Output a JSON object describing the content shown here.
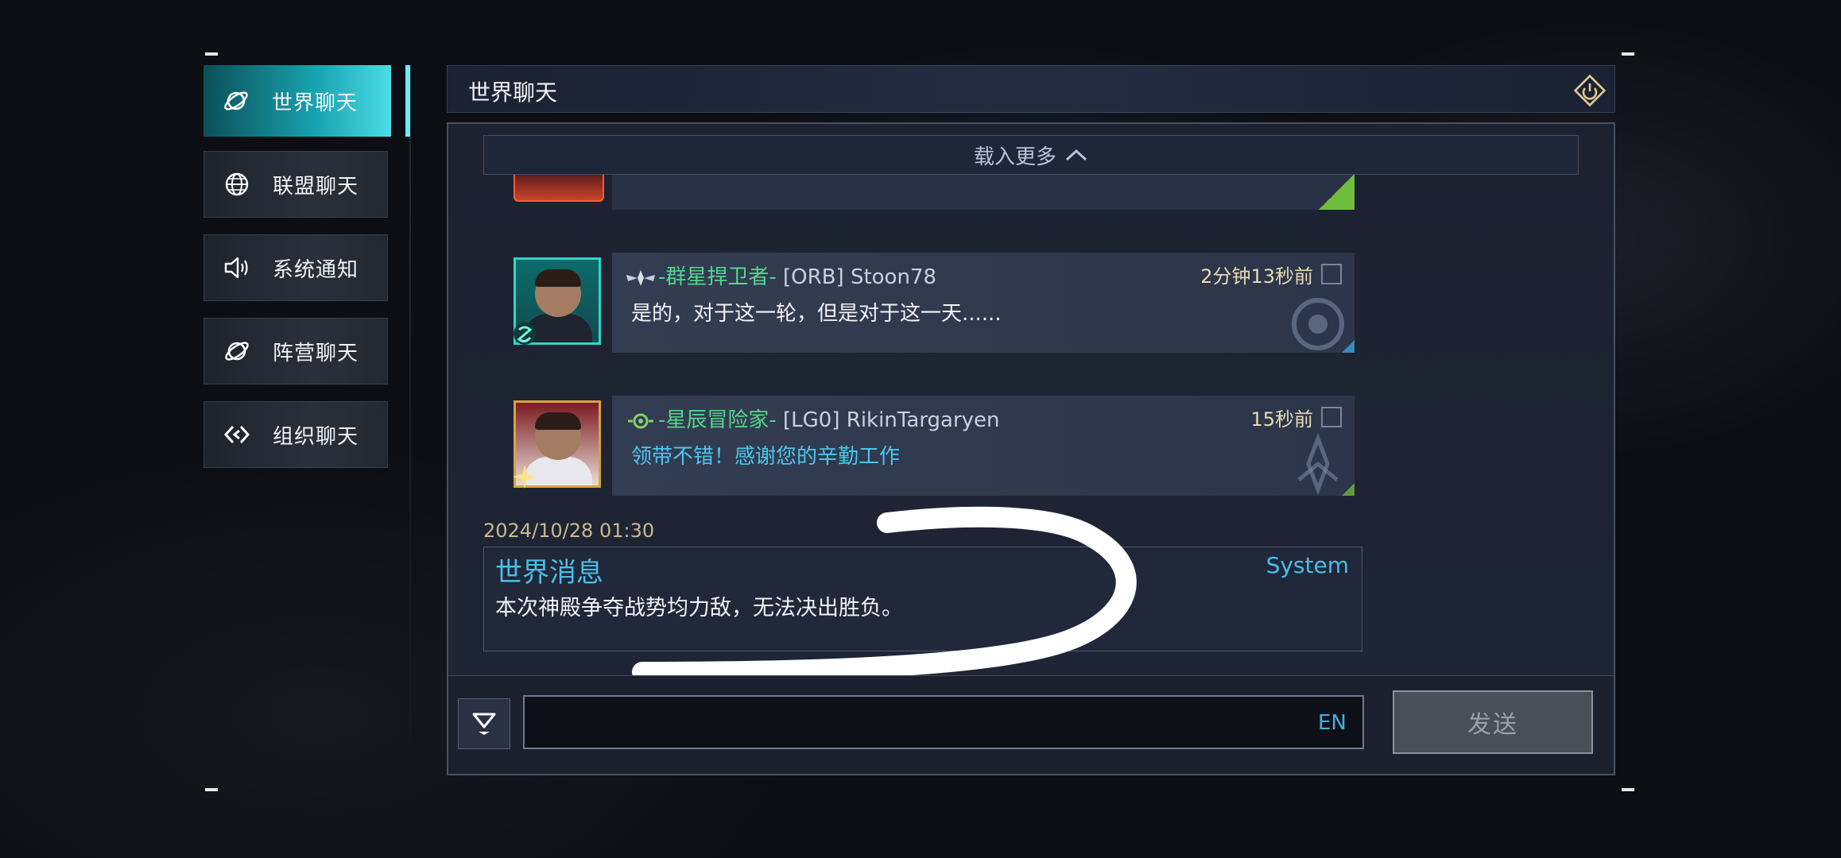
{
  "sidebar": {
    "items": [
      {
        "label": "世界聊天",
        "icon": "planet-icon",
        "active": true
      },
      {
        "label": "联盟聊天",
        "icon": "globe-icon",
        "active": false
      },
      {
        "label": "系统通知",
        "icon": "speaker-icon",
        "active": false
      },
      {
        "label": "阵营聊天",
        "icon": "planet-icon",
        "active": false
      },
      {
        "label": "组织聊天",
        "icon": "link-icon",
        "active": false
      }
    ]
  },
  "header": {
    "title": "世界聊天",
    "power_icon": "power-icon"
  },
  "chat": {
    "load_more": "载入更多",
    "messages": [
      {
        "guild": "-群星捍卫者-",
        "user": "[ORB] Stoon78",
        "time": "2分钟13秒前",
        "text": "是的，对于这一轮，但是对于这一天......",
        "accent": "#2fd6c8"
      },
      {
        "guild": "-星辰冒险家-",
        "user": "[LG0] RikinTargaryen",
        "time": "15秒前",
        "text": "领带不错！感谢您的辛勤工作",
        "accent": "#d7a43a"
      }
    ],
    "system": {
      "timestamp": "2024/10/28 01:30",
      "title": "世界消息",
      "tag": "System",
      "text": "本次神殿争夺战势均力敌，无法决出胜负。"
    }
  },
  "input": {
    "value": "",
    "lang": "EN",
    "send_label": "发送"
  },
  "colors": {
    "accent_cyan": "#18a3b0",
    "guild_green": "#54d68a",
    "system_blue": "#4bbde8"
  }
}
